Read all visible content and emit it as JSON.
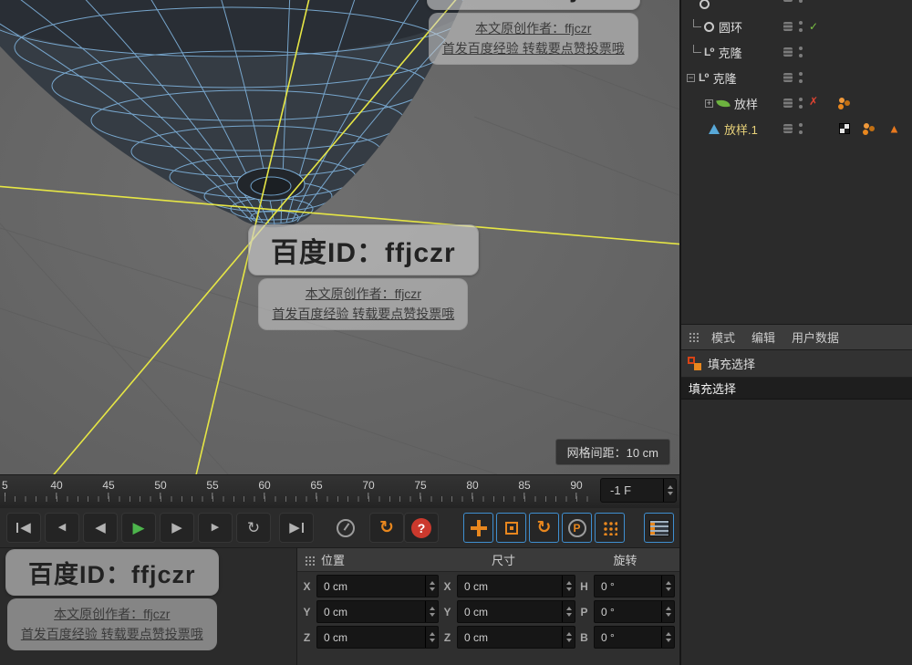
{
  "wm": {
    "id": "百度ID：ffjczr",
    "author": "本文原创作者：ffjczr",
    "footer": "首发百度经验 转载要点赞投票哦"
  },
  "viewport": {
    "grid_spacing": "网格间距：10 cm"
  },
  "object_manager": {
    "items": [
      {
        "label": "圆环"
      },
      {
        "label": "克隆"
      },
      {
        "label": "克隆"
      },
      {
        "label": "放样"
      },
      {
        "label": "放样.1"
      }
    ]
  },
  "panel": {
    "tabs": [
      {
        "label": "模式"
      },
      {
        "label": "编辑"
      },
      {
        "label": "用户数据"
      }
    ],
    "fill_label": "填充选择",
    "fill_header": "填充选择"
  },
  "timeline": {
    "partial": "5",
    "ticks": [
      "40",
      "45",
      "50",
      "55",
      "60",
      "65",
      "70",
      "75",
      "80",
      "85",
      "90"
    ],
    "frame": "-1 F"
  },
  "transport": {
    "to_start": "◀",
    "prev_key": "◀",
    "prev_frame": "◀",
    "play": "▶",
    "next_frame": "▶",
    "next_key": "▶",
    "loop": "↻",
    "to_end": "▶",
    "cycle": "↻",
    "help": "?",
    "rotate": "↻",
    "p_label": "P"
  },
  "icons": {
    "check": "✓",
    "cross": "✗",
    "warning": "▲",
    "plus": "+",
    "minus": "−",
    "clone": "L⁰"
  },
  "coords": {
    "headers": {
      "position": "位置",
      "size": "尺寸",
      "rotation": "旋转"
    },
    "rows": [
      {
        "pos_label": "X",
        "pos_value": "0 cm",
        "size_label": "X",
        "size_value": "0 cm",
        "rot_label": "H",
        "rot_value": "0 °"
      },
      {
        "pos_label": "Y",
        "pos_value": "0 cm",
        "size_label": "Y",
        "size_value": "0 cm",
        "rot_label": "P",
        "rot_value": "0 °"
      },
      {
        "pos_label": "Z",
        "pos_value": "0 cm",
        "size_label": "Z",
        "size_value": "0 cm",
        "rot_label": "B",
        "rot_value": "0 °"
      }
    ]
  }
}
